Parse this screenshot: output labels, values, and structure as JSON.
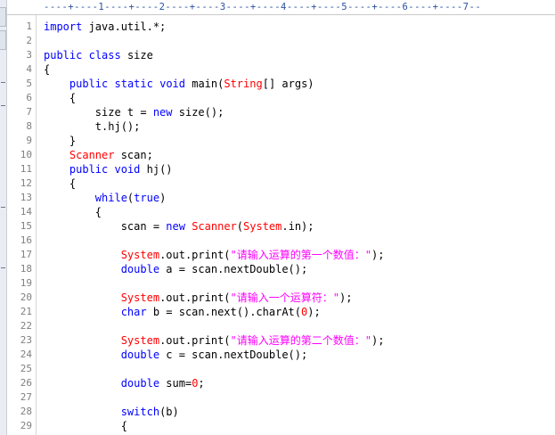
{
  "ruler": {
    "text": "----+----1----+----2----+----3----+----4----+----5----+----6----+----7--"
  },
  "lines": [
    {
      "n": "1",
      "t": [
        {
          "v": "import",
          "k": "kw"
        },
        {
          "v": " java.util.*;",
          "k": ""
        }
      ]
    },
    {
      "n": "2",
      "t": []
    },
    {
      "n": "3",
      "t": [
        {
          "v": "public",
          "k": "kw"
        },
        {
          "v": " ",
          "k": ""
        },
        {
          "v": "class",
          "k": "kw"
        },
        {
          "v": " size",
          "k": ""
        }
      ]
    },
    {
      "n": "4",
      "t": [
        {
          "v": "{",
          "k": ""
        }
      ]
    },
    {
      "n": "5",
      "t": [
        {
          "v": "    ",
          "k": ""
        },
        {
          "v": "public",
          "k": "kw"
        },
        {
          "v": " ",
          "k": ""
        },
        {
          "v": "static",
          "k": "kw"
        },
        {
          "v": " ",
          "k": ""
        },
        {
          "v": "void",
          "k": "kw"
        },
        {
          "v": " main(",
          "k": ""
        },
        {
          "v": "String",
          "k": "cls"
        },
        {
          "v": "[] args)",
          "k": ""
        }
      ]
    },
    {
      "n": "6",
      "t": [
        {
          "v": "    {",
          "k": ""
        }
      ]
    },
    {
      "n": "7",
      "t": [
        {
          "v": "        size t = ",
          "k": ""
        },
        {
          "v": "new",
          "k": "kw"
        },
        {
          "v": " size();",
          "k": ""
        }
      ]
    },
    {
      "n": "8",
      "t": [
        {
          "v": "        t.hj();",
          "k": ""
        }
      ]
    },
    {
      "n": "9",
      "t": [
        {
          "v": "    }",
          "k": ""
        }
      ]
    },
    {
      "n": "10",
      "t": [
        {
          "v": "    ",
          "k": ""
        },
        {
          "v": "Scanner",
          "k": "cls"
        },
        {
          "v": " scan;",
          "k": ""
        }
      ]
    },
    {
      "n": "11",
      "t": [
        {
          "v": "    ",
          "k": ""
        },
        {
          "v": "public",
          "k": "kw"
        },
        {
          "v": " ",
          "k": ""
        },
        {
          "v": "void",
          "k": "kw"
        },
        {
          "v": " hj()",
          "k": ""
        }
      ]
    },
    {
      "n": "12",
      "t": [
        {
          "v": "    {",
          "k": ""
        }
      ]
    },
    {
      "n": "13",
      "t": [
        {
          "v": "        ",
          "k": ""
        },
        {
          "v": "while",
          "k": "kw"
        },
        {
          "v": "(",
          "k": ""
        },
        {
          "v": "true",
          "k": "kw"
        },
        {
          "v": ")",
          "k": ""
        }
      ]
    },
    {
      "n": "14",
      "t": [
        {
          "v": "        {",
          "k": ""
        }
      ]
    },
    {
      "n": "15",
      "t": [
        {
          "v": "            scan = ",
          "k": ""
        },
        {
          "v": "new",
          "k": "kw"
        },
        {
          "v": " ",
          "k": ""
        },
        {
          "v": "Scanner",
          "k": "cls"
        },
        {
          "v": "(",
          "k": ""
        },
        {
          "v": "System",
          "k": "cls"
        },
        {
          "v": ".in);",
          "k": ""
        }
      ]
    },
    {
      "n": "16",
      "t": []
    },
    {
      "n": "17",
      "t": [
        {
          "v": "            ",
          "k": ""
        },
        {
          "v": "System",
          "k": "cls"
        },
        {
          "v": ".out.print(",
          "k": ""
        },
        {
          "v": "\"请输入运算的第一个数值：\"",
          "k": "str"
        },
        {
          "v": ");",
          "k": ""
        }
      ]
    },
    {
      "n": "18",
      "t": [
        {
          "v": "            ",
          "k": ""
        },
        {
          "v": "double",
          "k": "kw"
        },
        {
          "v": " a = scan.nextDouble();",
          "k": ""
        }
      ]
    },
    {
      "n": "19",
      "t": []
    },
    {
      "n": "20",
      "t": [
        {
          "v": "            ",
          "k": ""
        },
        {
          "v": "System",
          "k": "cls"
        },
        {
          "v": ".out.print(",
          "k": ""
        },
        {
          "v": "\"请输入一个运算符：\"",
          "k": "str"
        },
        {
          "v": ");",
          "k": ""
        }
      ]
    },
    {
      "n": "21",
      "t": [
        {
          "v": "            ",
          "k": ""
        },
        {
          "v": "char",
          "k": "kw"
        },
        {
          "v": " b = scan.next().charAt(",
          "k": ""
        },
        {
          "v": "0",
          "k": "num"
        },
        {
          "v": ");",
          "k": ""
        }
      ]
    },
    {
      "n": "22",
      "t": []
    },
    {
      "n": "23",
      "t": [
        {
          "v": "            ",
          "k": ""
        },
        {
          "v": "System",
          "k": "cls"
        },
        {
          "v": ".out.print(",
          "k": ""
        },
        {
          "v": "\"请输入运算的第二个数值：\"",
          "k": "str"
        },
        {
          "v": ");",
          "k": ""
        }
      ]
    },
    {
      "n": "24",
      "t": [
        {
          "v": "            ",
          "k": ""
        },
        {
          "v": "double",
          "k": "kw"
        },
        {
          "v": " c = scan.nextDouble();",
          "k": ""
        }
      ]
    },
    {
      "n": "25",
      "t": []
    },
    {
      "n": "26",
      "t": [
        {
          "v": "            ",
          "k": ""
        },
        {
          "v": "double",
          "k": "kw"
        },
        {
          "v": " sum=",
          "k": ""
        },
        {
          "v": "0",
          "k": "num"
        },
        {
          "v": ";",
          "k": ""
        }
      ]
    },
    {
      "n": "27",
      "t": []
    },
    {
      "n": "28",
      "t": [
        {
          "v": "            ",
          "k": ""
        },
        {
          "v": "switch",
          "k": "kw"
        },
        {
          "v": "(b)",
          "k": ""
        }
      ]
    },
    {
      "n": "29",
      "t": [
        {
          "v": "            {",
          "k": ""
        }
      ]
    }
  ]
}
